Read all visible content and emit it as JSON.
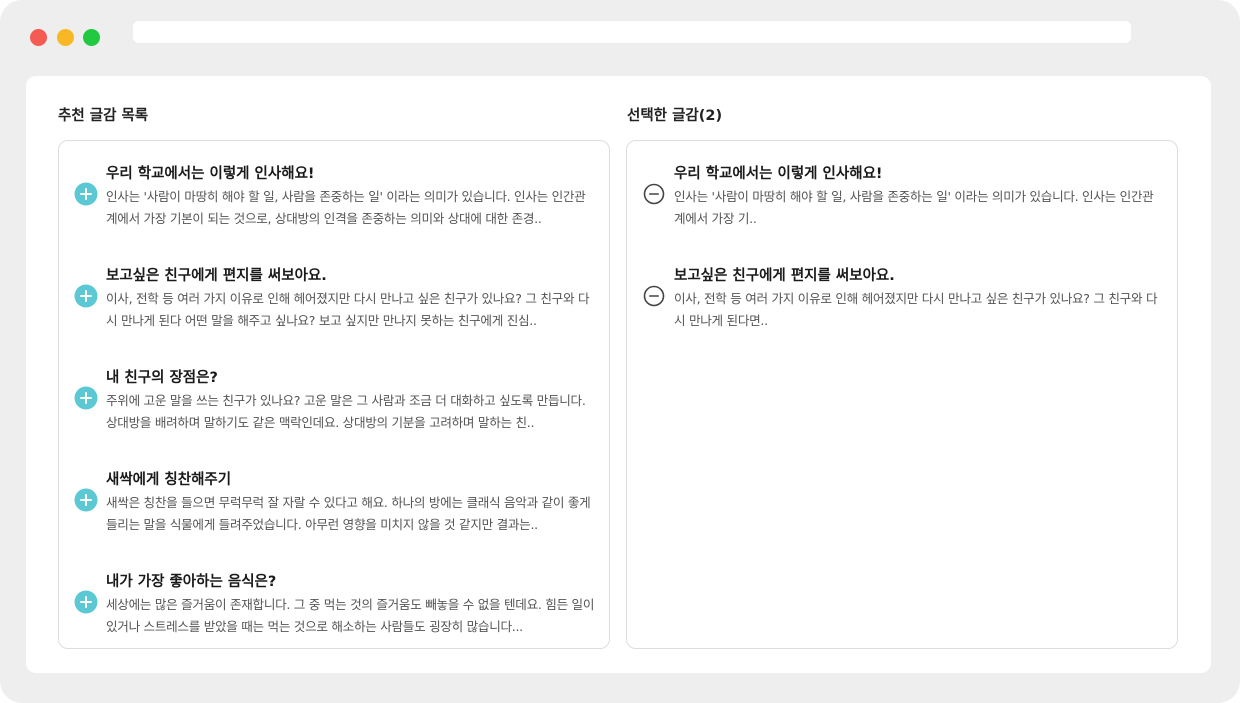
{
  "window": {
    "colors": {
      "close": "#f45b52",
      "minimize": "#f8b826",
      "maximize": "#22c840"
    }
  },
  "recommended": {
    "title": "추천 글감 목록",
    "add_icon_color": "#5bc8d4",
    "items": [
      {
        "title": "우리 학교에서는 이렇게 인사해요!",
        "desc": "인사는 '사람이 마땅히 해야 할 일, 사람을 존중하는 일' 이라는 의미가 있습니다. 인사는 인간관계에서 가장 기본이 되는 것으로, 상대방의 인격을 존중하는 의미와 상대에 대한 존경.."
      },
      {
        "title": "보고싶은 친구에게 편지를 써보아요.",
        "desc": "이사, 전학 등 여러 가지 이유로 인해 헤어졌지만 다시 만나고 싶은 친구가 있나요? 그 친구와 다시 만나게 된다 어떤 말을 해주고 싶나요? 보고 싶지만 만나지 못하는 친구에게 진심.."
      },
      {
        "title": "내 친구의 장점은?",
        "desc": "주위에 고운 말을 쓰는 친구가 있나요? 고운 말은 그 사람과 조금 더 대화하고 싶도록 만듭니다. 상대방을 배려하며 말하기도 같은 맥락인데요. 상대방의 기분을 고려하며 말하는 친.."
      },
      {
        "title": "새싹에게 칭찬해주기",
        "desc": "새싹은 칭찬을 들으면 무럭무럭 잘 자랄 수 있다고 해요. 하나의 방에는 클래식 음악과 같이 좋게 들리는 말을 식물에게 들려주었습니다. 아무런 영향을 미치지 않을 것 같지만 결과는.."
      },
      {
        "title": "내가 가장 좋아하는 음식은?",
        "desc": "세상에는 많은 즐거움이 존재합니다. 그 중 먹는 것의 즐거움도 빼놓을 수 없을 텐데요. 힘든 일이 있거나 스트레스를 받았을 때는 먹는 것으로 해소하는 사람들도 굉장히 많습니다..."
      }
    ]
  },
  "selected": {
    "title": "선택한 글감(2)",
    "items": [
      {
        "title": "우리 학교에서는 이렇게 인사해요!",
        "desc": "인사는 '사람이 마땅히 해야 할 일, 사람을 존중하는 일' 이라는 의미가 있습니다. 인사는 인간관계에서 가장 기.."
      },
      {
        "title": "보고싶은 친구에게 편지를 써보아요.",
        "desc": "이사, 전학 등 여러 가지 이유로 인해 헤어졌지만 다시 만나고 싶은 친구가 있나요? 그 친구와 다시 만나게 된다면.."
      }
    ]
  },
  "icons": {
    "add": "plus-circle-icon",
    "remove": "minus-circle-icon"
  }
}
